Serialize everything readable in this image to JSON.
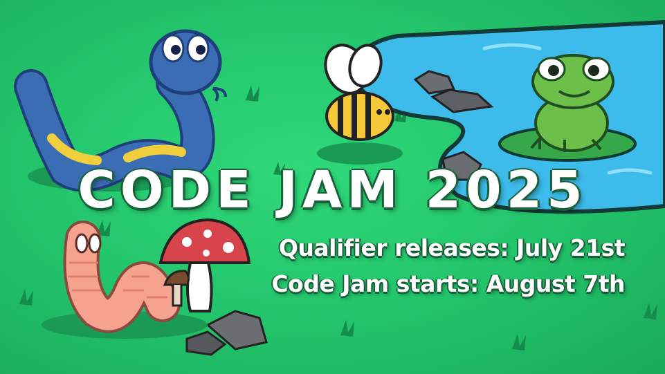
{
  "banner": {
    "title": "CODE JAM 2025",
    "qualifier_line": "Qualifier releases: July 21st",
    "start_line": "Code Jam starts: August 7th"
  },
  "colors": {
    "grass": "#22c36a",
    "pond": "#3dbbea",
    "snake_blue": "#3b6db5",
    "snake_yellow": "#f1cf3c",
    "frog_green": "#6cc04a",
    "worm_pink": "#f5a28e",
    "mushroom_red": "#d8444c",
    "rock_gray": "#6a6d72"
  },
  "icons": [
    "snake-icon",
    "bee-icon",
    "frog-icon",
    "worm-icon",
    "mushroom-icon",
    "rock-icon",
    "pond-icon"
  ]
}
